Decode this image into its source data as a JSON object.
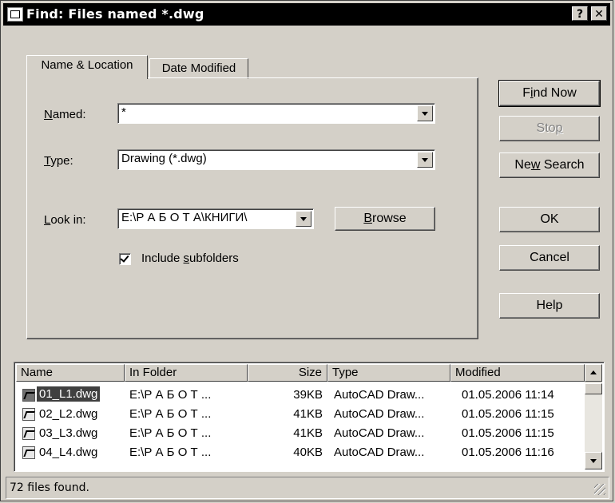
{
  "window": {
    "title": "Find: Files named *.dwg",
    "help_label": "?",
    "close_label": "✕"
  },
  "tabs": [
    {
      "label": "Name & Location",
      "active": true
    },
    {
      "label": "Date Modified",
      "active": false
    }
  ],
  "form": {
    "named_label_u": "N",
    "named_label_rest": "amed:",
    "named_value": "*",
    "type_label_u": "T",
    "type_label_rest": "ype:",
    "type_value": "Drawing (*.dwg)",
    "lookin_label_u": "L",
    "lookin_label_rest": "ook in:",
    "lookin_value": "E:\\Р А Б О Т А\\КНИГИ\\",
    "browse_u": "B",
    "browse_rest": "rowse",
    "include_pre": "Include ",
    "include_u": "s",
    "include_rest": "ubfolders",
    "include_checked": true
  },
  "buttons": {
    "find_pre": "F",
    "find_u": "i",
    "find_rest": "nd Now",
    "stop_pre": "Sto",
    "stop_u": "p",
    "new_pre": "Ne",
    "new_u": "w",
    "new_rest": " Search",
    "ok": "OK",
    "cancel": "Cancel",
    "help": "Help"
  },
  "results": {
    "columns": [
      "Name",
      "In Folder",
      "Size",
      "Type",
      "Modified"
    ],
    "rows": [
      {
        "name": "01_L1.dwg",
        "folder": "E:\\Р А Б О Т ...",
        "size": "39KB",
        "type": "AutoCAD Draw...",
        "modified": "01.05.2006 11:14",
        "selected": true
      },
      {
        "name": "02_L2.dwg",
        "folder": "E:\\Р А Б О Т ...",
        "size": "41KB",
        "type": "AutoCAD Draw...",
        "modified": "01.05.2006 11:15",
        "selected": false
      },
      {
        "name": "03_L3.dwg",
        "folder": "E:\\Р А Б О Т ...",
        "size": "41KB",
        "type": "AutoCAD Draw...",
        "modified": "01.05.2006 11:15",
        "selected": false
      },
      {
        "name": "04_L4.dwg",
        "folder": "E:\\Р А Б О Т ...",
        "size": "40KB",
        "type": "AutoCAD Draw...",
        "modified": "01.05.2006 11:16",
        "selected": false
      }
    ]
  },
  "status": {
    "text": "72 files found."
  },
  "colors": {
    "titlebar": "#000000",
    "face": "#d4d0c8",
    "selection": "#404040"
  }
}
